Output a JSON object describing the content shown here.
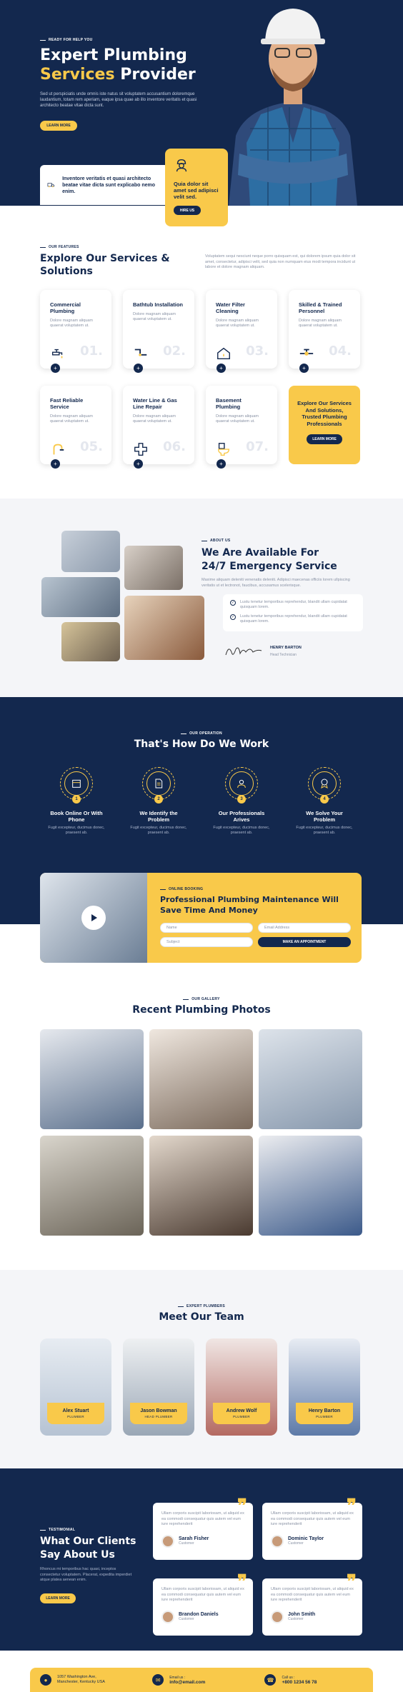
{
  "colors": {
    "navy": "#13284e",
    "accent": "#f9c94a"
  },
  "hero": {
    "tag": "READY FOR HELP YOU",
    "title_line1": "Expert Plumbing",
    "title_yellow": "Services",
    "title_rest": " Provider",
    "text": "Sed ut perspiciatis unde omnis iste natus sit voluptatem accusantium doloremque laudantium, totam rem aperiam, eaque ipsa quae ab illo inventore veritatis et quasi architecto beatae vitae dicta sunt.",
    "button": "LEARN MORE",
    "info_text": "Inventore veritatis et quasi architecto beatae vitae dicta sunt explicabo nemo enim.",
    "promo_text": "Quia dolor sit amet sed adipisci velit sed.",
    "promo_button": "HIRE US"
  },
  "services": {
    "tag": "OUR FEATURES",
    "title": "Explore Our Services & Solutions",
    "desc": "Voluptatem sequi nesciunt neque porro quisquam est, qui dolorem ipsum quia dolor sit amet, consectetur, adipisci velit, sed quia non numquam eius modi tempora incidunt ut labore et dolore magnam aliquam.",
    "items": [
      {
        "title": "Commercial Plumbing",
        "text": "Dolore magnam aliquam quaerat voluptatem ut.",
        "num": "01.",
        "icon": "faucet-icon"
      },
      {
        "title": "Bathtub Installation",
        "text": "Dolore magnam aliquam quaerat voluptatem ut.",
        "num": "02.",
        "icon": "pipe-icon"
      },
      {
        "title": "Water Filter Cleaning",
        "text": "Dolore magnam aliquam quaerat voluptatem ut.",
        "num": "03.",
        "icon": "house-icon"
      },
      {
        "title": "Skilled & Trained Personnel",
        "text": "Dolore magnam aliquam quaerat voluptatem ut.",
        "num": "04.",
        "icon": "valve-icon"
      },
      {
        "title": "Fast Reliable Service",
        "text": "Dolore magnam aliquam quaerat voluptatem ut.",
        "num": "05.",
        "icon": "tap-icon"
      },
      {
        "title": "Water Line & Gas Line Repair",
        "text": "Dolore magnam aliquam quaerat voluptatem ut.",
        "num": "06.",
        "icon": "cross-pipe-icon"
      },
      {
        "title": "Basement Plumbing",
        "text": "Dolore magnam aliquam quaerat voluptatem ut.",
        "num": "07.",
        "icon": "toilet-icon"
      }
    ],
    "promo_title": "Explore Our Services And Solutions, Trusted Plumbing Professionals",
    "promo_button": "LEARN MORE"
  },
  "about": {
    "tag": "ABOUT US",
    "title": "We Are Available For 24/7 Emergency Service",
    "text": "Maxime aliquam deleniti venenatis deleniti. Adipisci maecenas officiis lorem ullpiscing veritatis ut et lectronot, faucibus, accusamus scelerisque.",
    "checks": [
      "Lustu tenetur temporibus reprehendur, blandit ullam cupidatat quisquam lorem.",
      "Lustu tenetur temporibus reprehendur, blandit ullam cupidatat quisquam lorem."
    ],
    "person_name": "HENRY BARTON",
    "person_role": "Head Technician"
  },
  "process": {
    "tag": "OUR OPERATION",
    "title": "That's How Do We Work",
    "steps": [
      {
        "title": "Book Online Or With Phone",
        "text": "Fugit excepteur, ducimus donec, praesent ab.",
        "num": "1"
      },
      {
        "title": "We Identify the Problem",
        "text": "Fugit excepteur, ducimus donec, praesent ab.",
        "num": "2"
      },
      {
        "title": "Our Professionals Arives",
        "text": "Fugit excepteur, ducimus donec, praesent ab.",
        "num": "3"
      },
      {
        "title": "We Solve Your Problem",
        "text": "Fugit excepteur, ducimus donec, praesent ab.",
        "num": "4"
      }
    ]
  },
  "booking": {
    "tag": "ONLINE BOOKING",
    "title": "Professional Plumbing Maintenance Will Save Time And Money",
    "name_ph": "Name",
    "email_ph": "Email Address",
    "subject_ph": "Subject",
    "button": "MAKE AN APPOINTMENT"
  },
  "gallery": {
    "tag": "OUR GALLERY",
    "title": "Recent Plumbing Photos"
  },
  "team": {
    "tag": "EXPERT PLUMBERS",
    "title": "Meet Our Team",
    "members": [
      {
        "name": "Alex Stuart",
        "role": "PLUMBER"
      },
      {
        "name": "Jason Bowman",
        "role": "HEAD PLUMBER"
      },
      {
        "name": "Andrew Wolf",
        "role": "PLUMBER"
      },
      {
        "name": "Henry Barton",
        "role": "PLUMBER"
      }
    ]
  },
  "testimonials": {
    "tag": "TESTIMONIAL",
    "title": "What Our Clients Say About Us",
    "text": "Rhoncus mi temporibus hac quasi, inceptos consectetur voluptatem. Placerat, expedita imperdiet atque platea aenean enim.",
    "button": "LEARN MORE",
    "items": [
      {
        "text": "Ullam corporis suscipit laboriosam, ut aliquid ex ea commodi consequatur quis autem vel eum iure reprehenderit",
        "name": "Sarah Fisher",
        "role": "Customer"
      },
      {
        "text": "Ullam corporis suscipit laboriosam, ut aliquid ex ea commodi consequatur quis autem vel eum iure reprehenderit",
        "name": "Dominic Taylor",
        "role": "Customer"
      },
      {
        "text": "Ullam corporis suscipit laboriosam, ut aliquid ex ea commodi consequatur quis autem vel eum iure reprehenderit",
        "name": "Brandon Daniels",
        "role": "Customer"
      },
      {
        "text": "Ullam corporis suscipit laboriosam, ut aliquid ex ea commodi consequatur quis autem vel eum iure reprehenderit",
        "name": "John Smith",
        "role": "Customer"
      }
    ]
  },
  "footer": {
    "address": "1057 Washington Ave, Manchester, Kentucky USA",
    "email_label": "Email us :",
    "email": "info@email.com",
    "call_label": "Call us :",
    "phone": "+800 1234 56 78"
  }
}
